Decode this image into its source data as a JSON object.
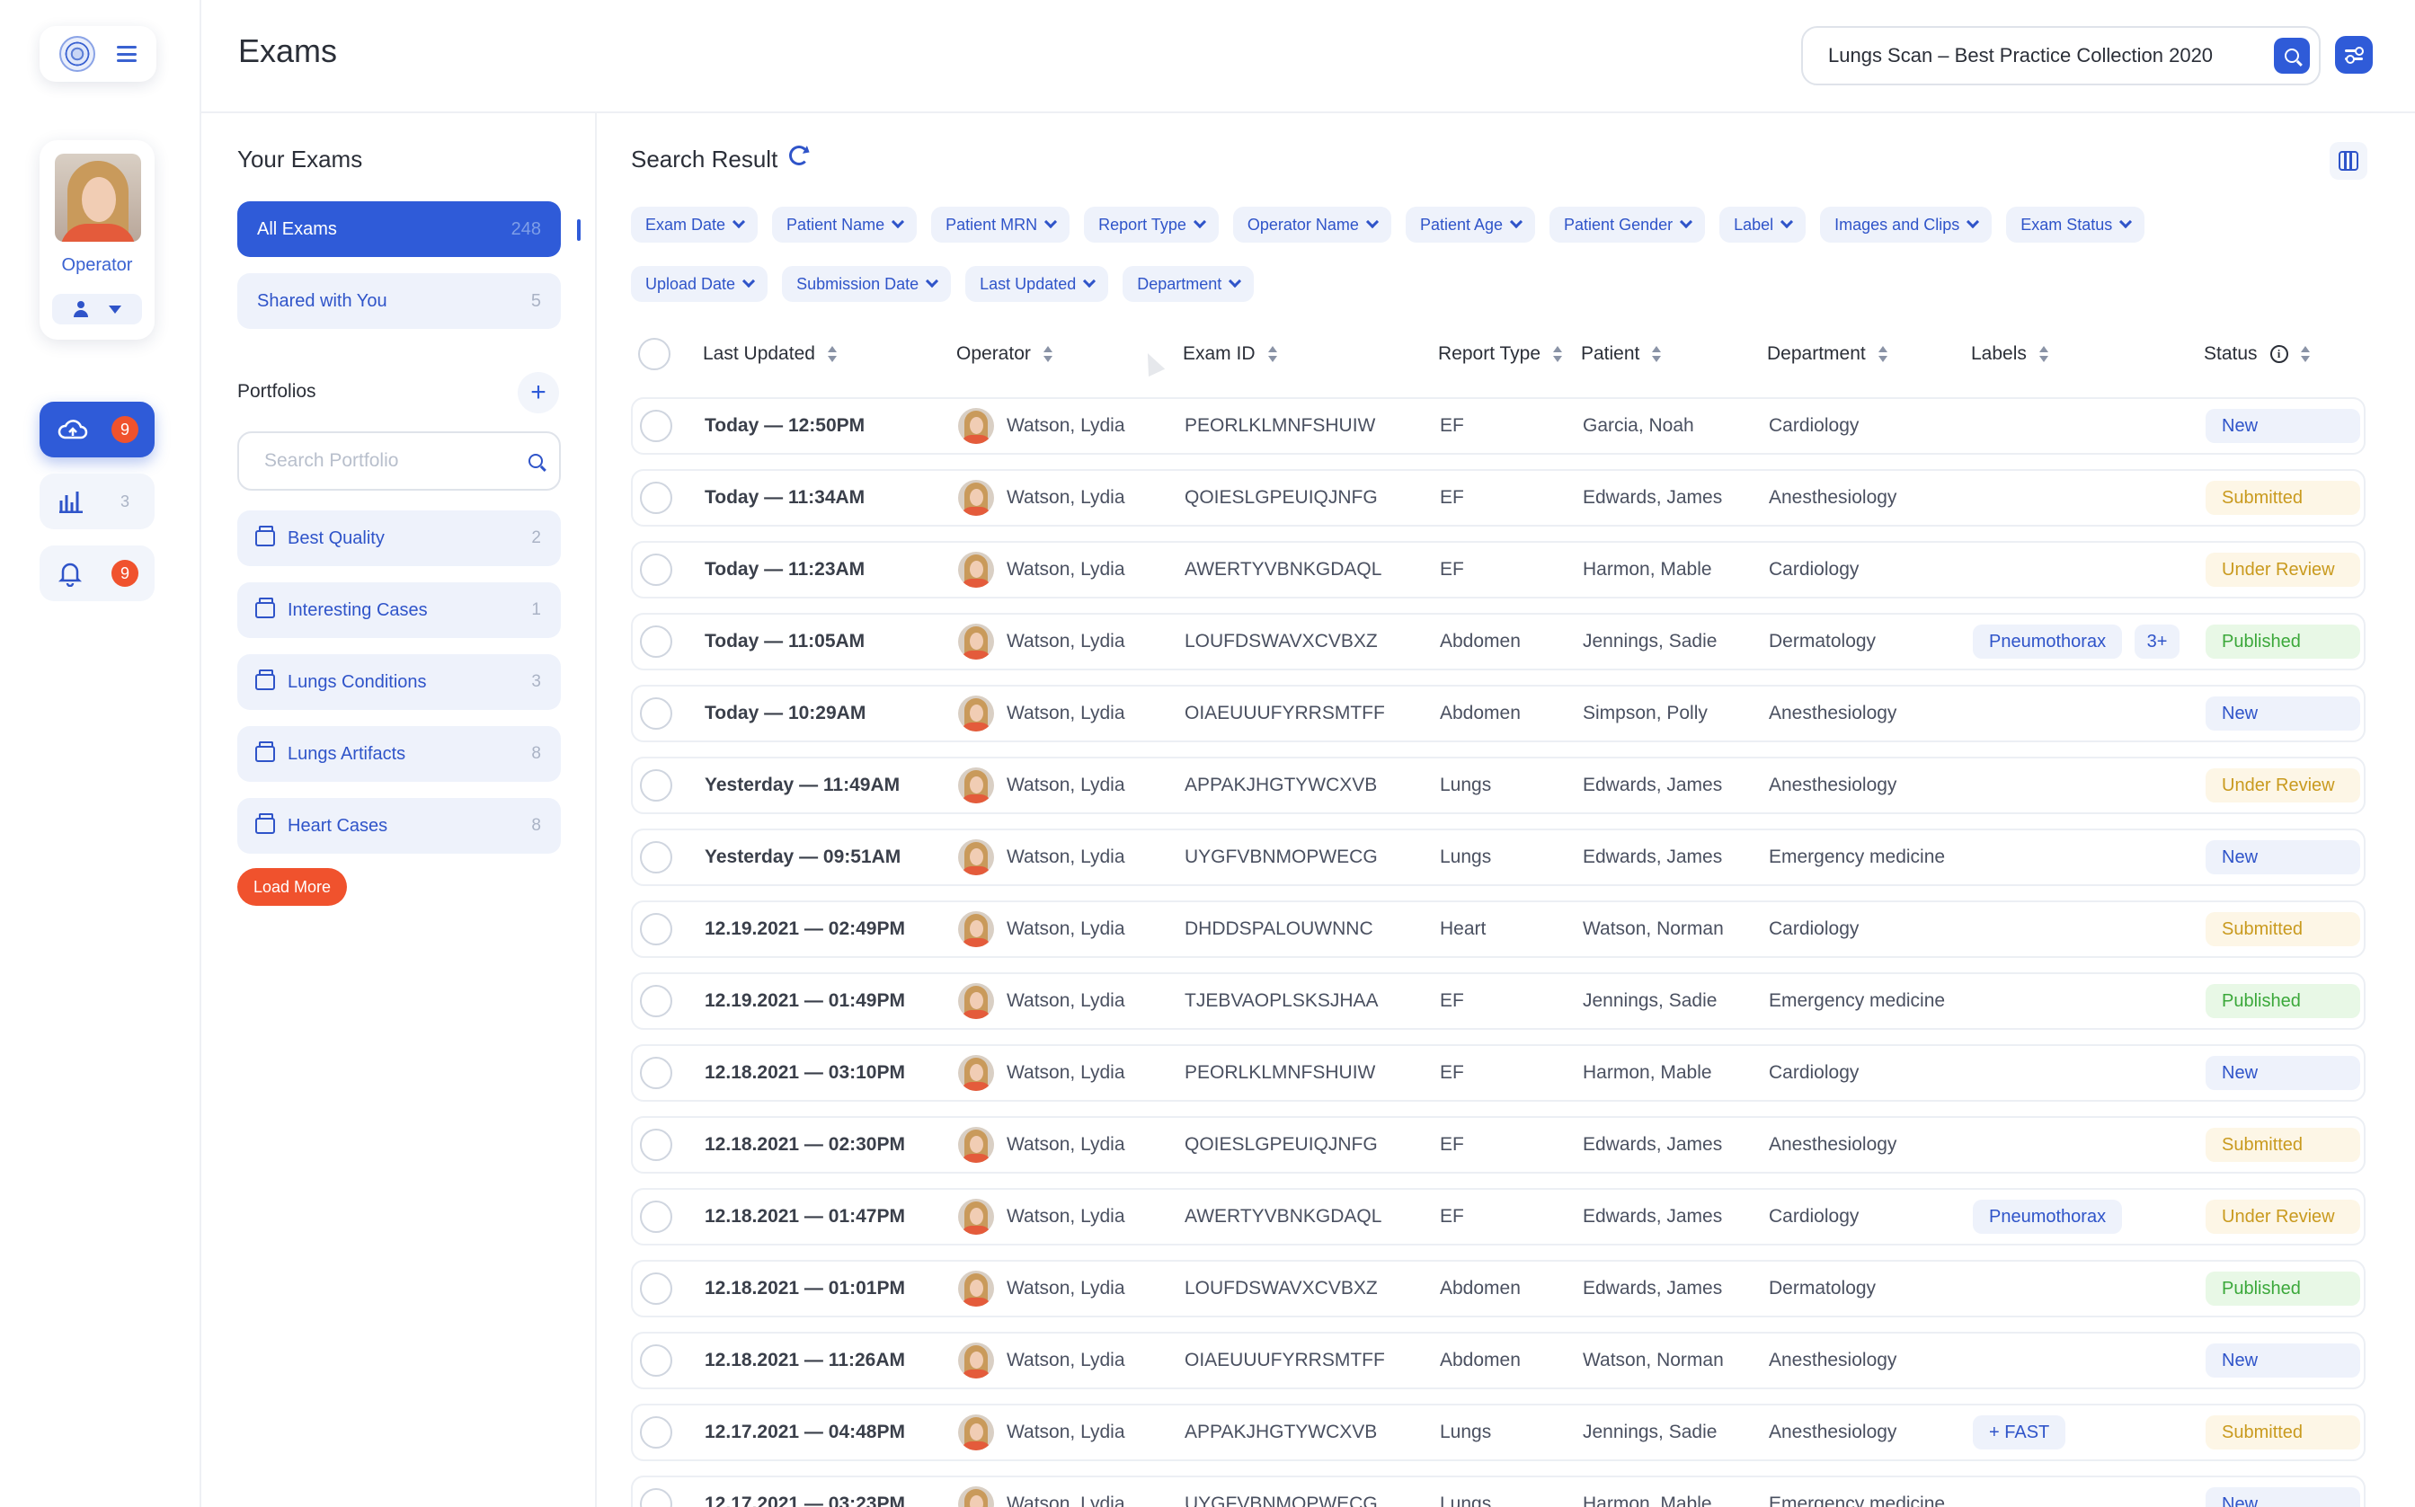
{
  "header": {
    "title": "Exams",
    "search_value": "Lungs Scan – Best Practice Collection 2020"
  },
  "rail": {
    "profile_role": "Operator",
    "items": [
      {
        "icon": "cloud-upload-icon",
        "count": "9",
        "badge": true
      },
      {
        "icon": "bar-chart-icon",
        "count": "3",
        "badge": false
      },
      {
        "icon": "bell-icon",
        "count": "9",
        "badge": true
      }
    ]
  },
  "panel": {
    "heading": "Your Exams",
    "tabs": [
      {
        "label": "All Exams",
        "count": "248"
      },
      {
        "label": "Shared with You",
        "count": "5"
      }
    ],
    "portfolios_heading": "Portfolios",
    "search_placeholder": "Search Portfolio",
    "portfolios": [
      {
        "name": "Best Quality",
        "count": "2"
      },
      {
        "name": "Interesting Cases",
        "count": "1"
      },
      {
        "name": "Lungs Conditions",
        "count": "3"
      },
      {
        "name": "Lungs Artifacts",
        "count": "8"
      },
      {
        "name": "Heart Cases",
        "count": "8"
      }
    ],
    "load_more": "Load More"
  },
  "main": {
    "result_title": "Search Result",
    "filters_row1": [
      "Exam Date",
      "Patient Name",
      "Patient MRN",
      "Report Type",
      "Operator Name",
      "Patient Age",
      "Patient Gender",
      "Label",
      "Images and Clips",
      "Exam Status"
    ],
    "filters_row2": [
      "Upload Date",
      "Submission Date",
      "Last Updated",
      "Department"
    ],
    "columns": {
      "last_updated": "Last Updated",
      "operator": "Operator",
      "exam_id": "Exam ID",
      "report_type": "Report Type",
      "patient": "Patient",
      "department": "Department",
      "labels": "Labels",
      "status": "Status"
    },
    "rows": [
      {
        "date": "Today — 12:50PM",
        "operator": "Watson, Lydia",
        "exam_id": "PEORLKLMNFSHUIW",
        "report": "EF",
        "patient": "Garcia, Noah",
        "department": "Cardiology",
        "labels": [],
        "more": "",
        "status": "New",
        "status_kind": "new"
      },
      {
        "date": "Today — 11:34AM",
        "operator": "Watson, Lydia",
        "exam_id": "QOIESLGPEUIQJNFG",
        "report": "EF",
        "patient": "Edwards, James",
        "department": "Anesthesiology",
        "labels": [],
        "more": "",
        "status": "Submitted",
        "status_kind": "submitted"
      },
      {
        "date": "Today — 11:23AM",
        "operator": "Watson, Lydia",
        "exam_id": "AWERTYVBNKGDAQL",
        "report": "EF",
        "patient": "Harmon, Mable",
        "department": "Cardiology",
        "labels": [],
        "more": "",
        "status": "Under Review",
        "status_kind": "review"
      },
      {
        "date": "Today — 11:05AM",
        "operator": "Watson, Lydia",
        "exam_id": "LOUFDSWAVXCVBXZ",
        "report": "Abdomen",
        "patient": "Jennings, Sadie",
        "department": "Dermatology",
        "labels": [
          "Pneumothorax"
        ],
        "more": "3+",
        "status": "Published",
        "status_kind": "published"
      },
      {
        "date": "Today — 10:29AM",
        "operator": "Watson, Lydia",
        "exam_id": "OIAEUUUFYRRSMTFF",
        "report": "Abdomen",
        "patient": "Simpson, Polly",
        "department": "Anesthesiology",
        "labels": [],
        "more": "",
        "status": "New",
        "status_kind": "new"
      },
      {
        "date": "Yesterday — 11:49AM",
        "operator": "Watson, Lydia",
        "exam_id": "APPAKJHGTYWCXVB",
        "report": "Lungs",
        "patient": "Edwards, James",
        "department": "Anesthesiology",
        "labels": [],
        "more": "",
        "status": "Under Review",
        "status_kind": "review"
      },
      {
        "date": "Yesterday — 09:51AM",
        "operator": "Watson, Lydia",
        "exam_id": "UYGFVBNMOPWECG",
        "report": "Lungs",
        "patient": "Edwards, James",
        "department": "Emergency medicine",
        "labels": [],
        "more": "",
        "status": "New",
        "status_kind": "new"
      },
      {
        "date": "12.19.2021 — 02:49PM",
        "operator": "Watson, Lydia",
        "exam_id": "DHDDSPALOUWNNC",
        "report": "Heart",
        "patient": "Watson, Norman",
        "department": "Cardiology",
        "labels": [],
        "more": "",
        "status": "Submitted",
        "status_kind": "submitted"
      },
      {
        "date": "12.19.2021 — 01:49PM",
        "operator": "Watson, Lydia",
        "exam_id": "TJEBVAOPLSKSJHAA",
        "report": "EF",
        "patient": "Jennings, Sadie",
        "department": "Emergency medicine",
        "labels": [],
        "more": "",
        "status": "Published",
        "status_kind": "published"
      },
      {
        "date": "12.18.2021 — 03:10PM",
        "operator": "Watson, Lydia",
        "exam_id": "PEORLKLMNFSHUIW",
        "report": "EF",
        "patient": "Harmon, Mable",
        "department": "Cardiology",
        "labels": [],
        "more": "",
        "status": "New",
        "status_kind": "new"
      },
      {
        "date": "12.18.2021 — 02:30PM",
        "operator": "Watson, Lydia",
        "exam_id": "QOIESLGPEUIQJNFG",
        "report": "EF",
        "patient": "Edwards, James",
        "department": "Anesthesiology",
        "labels": [],
        "more": "",
        "status": "Submitted",
        "status_kind": "submitted"
      },
      {
        "date": "12.18.2021 — 01:47PM",
        "operator": "Watson, Lydia",
        "exam_id": "AWERTYVBNKGDAQL",
        "report": "EF",
        "patient": "Edwards, James",
        "department": "Cardiology",
        "labels": [
          "Pneumothorax"
        ],
        "more": "",
        "status": "Under Review",
        "status_kind": "review"
      },
      {
        "date": "12.18.2021 — 01:01PM",
        "operator": "Watson, Lydia",
        "exam_id": "LOUFDSWAVXCVBXZ",
        "report": "Abdomen",
        "patient": "Edwards, James",
        "department": "Dermatology",
        "labels": [],
        "more": "",
        "status": "Published",
        "status_kind": "published"
      },
      {
        "date": "12.18.2021 — 11:26AM",
        "operator": "Watson, Lydia",
        "exam_id": "OIAEUUUFYRRSMTFF",
        "report": "Abdomen",
        "patient": "Watson, Norman",
        "department": "Anesthesiology",
        "labels": [],
        "more": "",
        "status": "New",
        "status_kind": "new"
      },
      {
        "date": "12.17.2021 — 04:48PM",
        "operator": "Watson, Lydia",
        "exam_id": "APPAKJHGTYWCXVB",
        "report": "Lungs",
        "patient": "Jennings, Sadie",
        "department": "Anesthesiology",
        "labels": [
          "+ FAST"
        ],
        "more": "",
        "status": "Submitted",
        "status_kind": "submitted"
      },
      {
        "date": "12.17.2021 — 03:23PM",
        "operator": "Watson, Lydia",
        "exam_id": "UYGFVBNMOPWECG",
        "report": "Lungs",
        "patient": "Harmon, Mable",
        "department": "Emergency medicine",
        "labels": [],
        "more": "",
        "status": "New",
        "status_kind": "new"
      }
    ]
  },
  "colors": {
    "accent": "#2f5bd8",
    "badge": "#f0522d",
    "status_new": "#2f54c9",
    "status_pending": "#c99a1e",
    "status_published": "#3ba83a"
  }
}
